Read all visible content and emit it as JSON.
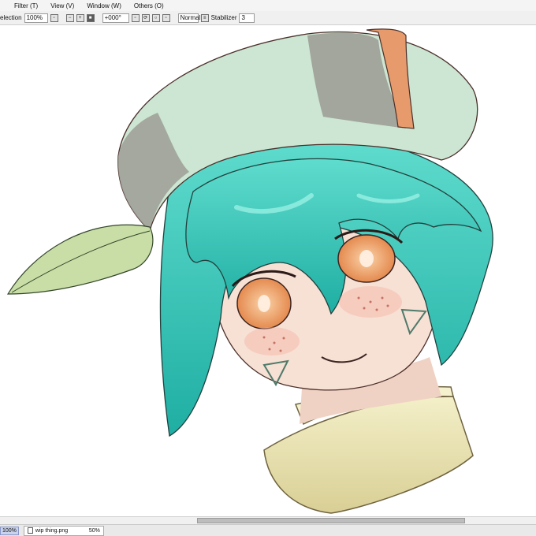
{
  "menu": {
    "items": [
      "Filter (T)",
      "View (V)",
      "Window (W)",
      "Others (O)"
    ]
  },
  "toolbar": {
    "selection_label": "election",
    "zoom_value": "100%",
    "rotation_value": "+000°",
    "blend_mode": "Normal",
    "stabilizer_label": "Stabilizer",
    "stabilizer_value": "3"
  },
  "statusbar": {
    "zoom": "100%",
    "file_name": "wip thing.png",
    "file_zoom": "50%"
  },
  "colors": {
    "hair": "#2fc7b8",
    "hat_light": "#cde8d4",
    "hat_grey": "#9a9a92",
    "hat_band": "#e79a6b",
    "leaf": "#c8dea6",
    "skin": "#f6ddd1",
    "eye": "#f2a86f",
    "collar": "#ece6b9"
  },
  "icons": {
    "toolbar": [
      "square-tool-icon",
      "minus-icon",
      "cross-icon",
      "close-icon",
      "rotate-icon",
      "reset-rotate-icon",
      "flip-icon",
      "blend-list-icon"
    ]
  }
}
